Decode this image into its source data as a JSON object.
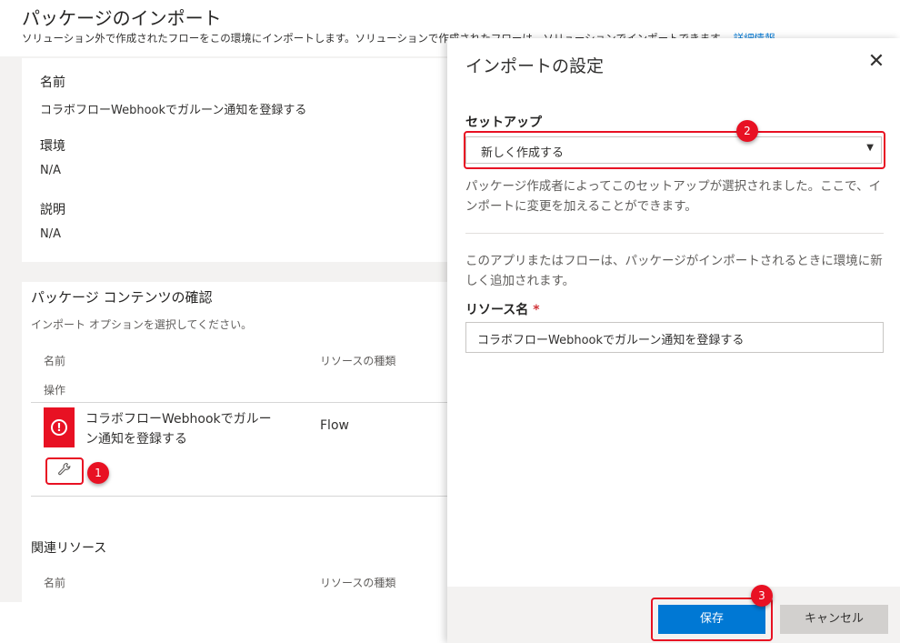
{
  "page": {
    "title": "パッケージのインポート",
    "subtitle": "ソリューション外で作成されたフローをこの環境にインポートします。ソリューションで作成されたフローは、ソリューションでインポートできます。",
    "learn_more": "詳細情報"
  },
  "details": {
    "name_label": "名前",
    "name_value": "コラボフローWebhookでガルーン通知を登録する",
    "env_label": "環境",
    "env_value": "N/A",
    "desc_label": "説明",
    "desc_value": "N/A"
  },
  "review": {
    "title": "パッケージ コンテンツの確認",
    "instruction": "インポート オプションを選択してください。",
    "col_name": "名前",
    "col_type": "リソースの種類",
    "col_action": "操作",
    "row": {
      "name_line1": "コラボフローWebhookでガルー",
      "name_line2": "ン通知を登録する",
      "type": "Flow"
    },
    "related_title": "関連リソース",
    "related_col_name": "名前",
    "related_col_type": "リソースの種類"
  },
  "dialog": {
    "title": "インポートの設定",
    "setup_label": "セットアップ",
    "setup_value": "新しく作成する",
    "setup_desc": "パッケージ作成者によってこのセットアップが選択されました。ここで、インポートに変更を加えることができます。",
    "add_desc": "このアプリまたはフローは、パッケージがインポートされるときに環境に新しく追加されます。",
    "resource_label": "リソース名",
    "required_mark": "*",
    "resource_value": "コラボフローWebhookでガルーン通知を登録する",
    "save": "保存",
    "cancel": "キャンセル"
  },
  "annotations": {
    "one": "1",
    "two": "2",
    "three": "3"
  },
  "icons": {
    "close": "close-icon",
    "error": "error-icon",
    "wrench": "wrench-icon",
    "dropdown": "chevron-down-icon"
  },
  "colors": {
    "accent": "#0078d4",
    "error": "#e81123",
    "callout": "#e81123"
  }
}
